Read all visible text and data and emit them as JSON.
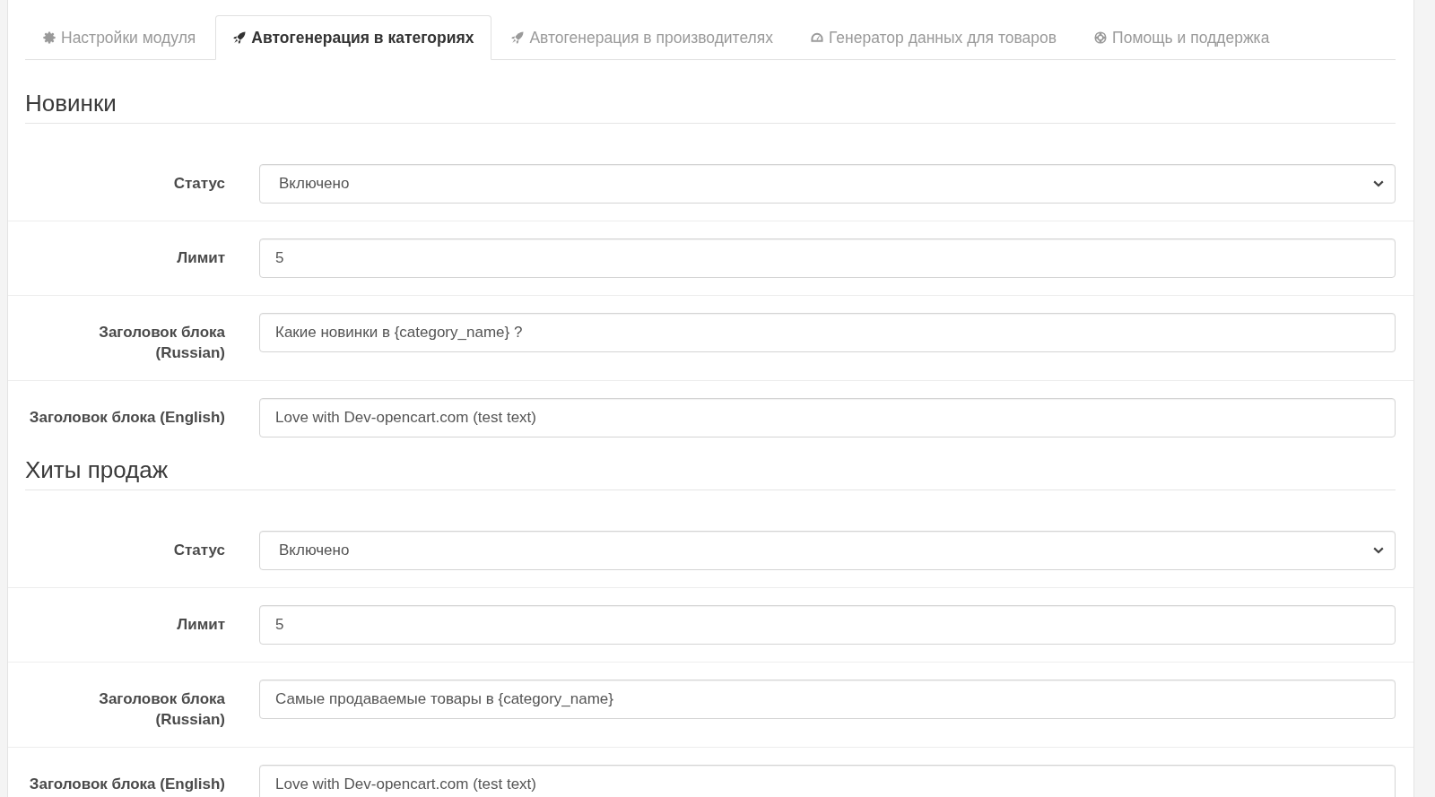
{
  "tabs": [
    {
      "label": "Настройки модуля",
      "selected": false
    },
    {
      "label": "Автогенерация в категориях",
      "selected": true
    },
    {
      "label": "Автогенерация в производителях",
      "selected": false
    },
    {
      "label": "Генератор данных для товаров",
      "selected": false
    },
    {
      "label": "Помощь и поддержка",
      "selected": false
    }
  ],
  "sections": [
    {
      "title": "Новинки",
      "fields": [
        {
          "kind": "select",
          "label": "Статус",
          "value": "Включено"
        },
        {
          "kind": "text",
          "label": "Лимит",
          "value": "5"
        },
        {
          "kind": "text",
          "label": "Заголовок блока (Russian)",
          "value": "Какие новинки в {category_name} ?"
        },
        {
          "kind": "text",
          "label": "Заголовок блока (English)",
          "value": "Love with Dev-opencart.com (test text)"
        }
      ]
    },
    {
      "title": "Хиты продаж",
      "fields": [
        {
          "kind": "select",
          "label": "Статус",
          "value": "Включено"
        },
        {
          "kind": "text",
          "label": "Лимит",
          "value": "5"
        },
        {
          "kind": "text",
          "label": "Заголовок блока (Russian)",
          "value": "Самые продаваемые товары в {category_name}"
        },
        {
          "kind": "text",
          "label": "Заголовок блока (English)",
          "value": "Love with Dev-opencart.com (test text)"
        }
      ]
    }
  ]
}
